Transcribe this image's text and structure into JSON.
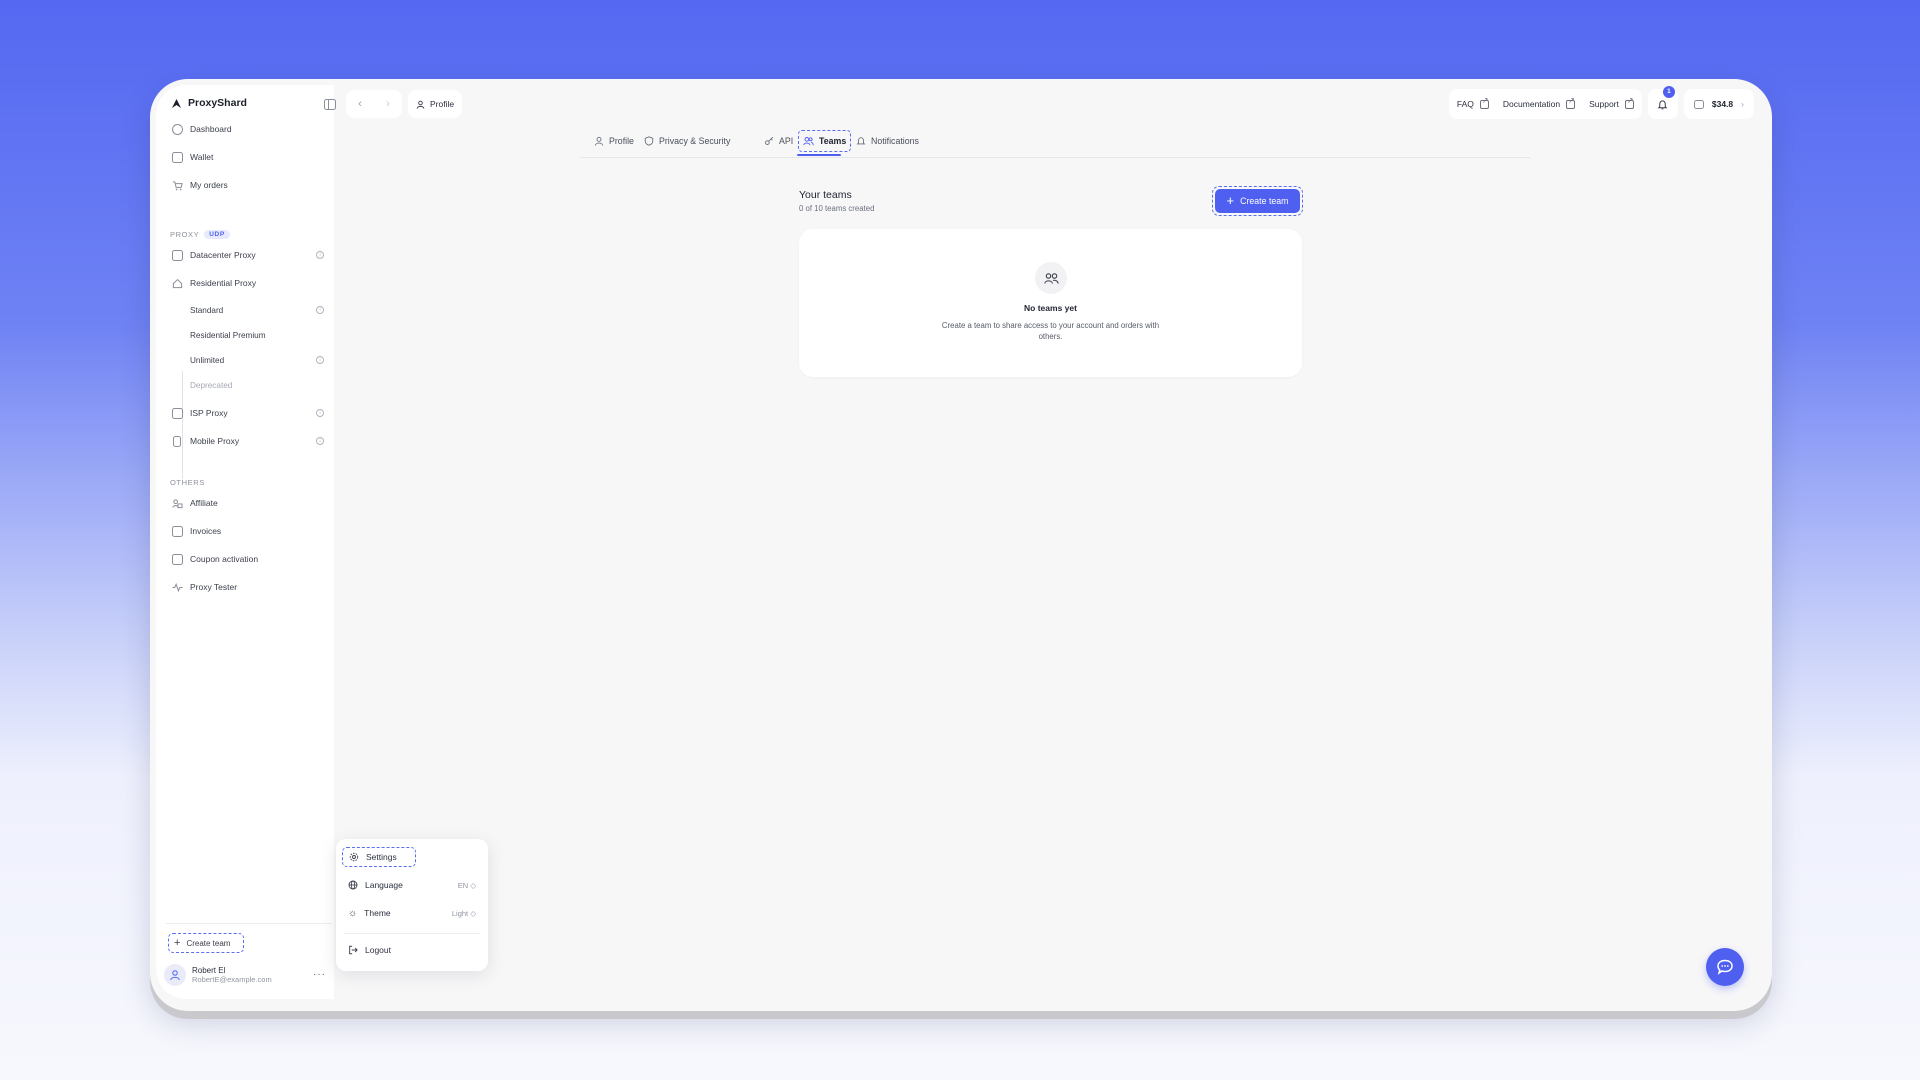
{
  "app": {
    "name": "ProxyShard"
  },
  "sidebar": {
    "main_items": [
      {
        "label": "Dashboard",
        "icon": "dashboard-icon"
      },
      {
        "label": "Wallet",
        "icon": "wallet-icon"
      },
      {
        "label": "My orders",
        "icon": "cart-icon"
      }
    ],
    "proxy_section": {
      "label": "PROXY",
      "badge": "UDP"
    },
    "proxy_items": {
      "datacenter": "Datacenter Proxy",
      "residential": "Residential Proxy",
      "residential_sub": [
        "Standard",
        "Residential Premium",
        "Unlimited",
        "Deprecated"
      ],
      "isp": "ISP Proxy",
      "mobile": "Mobile Proxy"
    },
    "others_section": {
      "label": "OTHERS"
    },
    "others_items": [
      {
        "label": "Affiliate",
        "icon": "affiliate-icon"
      },
      {
        "label": "Invoices",
        "icon": "invoice-icon"
      },
      {
        "label": "Coupon activation",
        "icon": "coupon-icon"
      },
      {
        "label": "Proxy Tester",
        "icon": "pulse-icon"
      }
    ],
    "create_team_label": "Create team",
    "user": {
      "name": "Robert El",
      "email": "RobertE@example.com"
    }
  },
  "topbar": {
    "breadcrumb": "Profile",
    "links": [
      {
        "label": "FAQ"
      },
      {
        "label": "Documentation"
      },
      {
        "label": "Support"
      }
    ],
    "notifications_count": "1",
    "balance": "$34.8"
  },
  "tabs": [
    {
      "label": "Profile",
      "icon": "user-icon",
      "active": false
    },
    {
      "label": "Privacy & Security",
      "icon": "shield-icon",
      "active": false
    },
    {
      "label": "API",
      "icon": "key-icon",
      "active": false
    },
    {
      "label": "Teams",
      "icon": "users-icon",
      "active": true
    },
    {
      "label": "Notifications",
      "icon": "bell-icon",
      "active": false
    }
  ],
  "teams": {
    "title": "Your teams",
    "subtitle": "0 of 10 teams created",
    "create_button": "Create team",
    "empty_title": "No teams yet",
    "empty_desc": "Create a team to share access to your account and orders with others."
  },
  "popup_menu": {
    "settings": "Settings",
    "language": {
      "label": "Language",
      "value": "EN"
    },
    "theme": {
      "label": "Theme",
      "value": "Light"
    },
    "logout": "Logout"
  },
  "colors": {
    "accent": "#4f5ff0",
    "background_top": "#5468f2"
  }
}
